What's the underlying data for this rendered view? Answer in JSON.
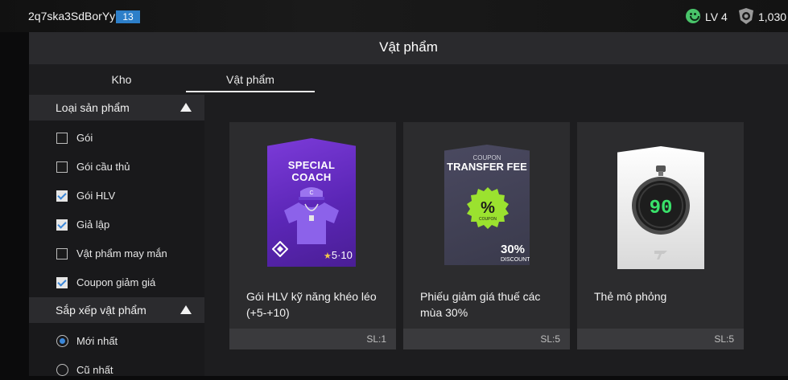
{
  "header": {
    "username": "2q7ska3SdBorYy",
    "badge": "13",
    "level": "LV 4",
    "currency": "1,030"
  },
  "title": "Vật phẩm",
  "tabs": [
    {
      "label": "Kho"
    },
    {
      "label": "Vật phẩm",
      "active": true
    }
  ],
  "sidebar": {
    "product_type_label": "Loại sản phẩm",
    "filters": [
      {
        "label": "Gói",
        "checked": false
      },
      {
        "label": "Gói cầu thủ",
        "checked": false
      },
      {
        "label": "Gói HLV",
        "checked": true
      },
      {
        "label": "Giả lập",
        "checked": true
      },
      {
        "label": "Vật phẩm may mắn",
        "checked": false
      },
      {
        "label": "Coupon giảm giá",
        "checked": true
      }
    ],
    "sort_label": "Sắp xếp vật phẩm",
    "sort_options": [
      {
        "label": "Mới nhất",
        "selected": true
      },
      {
        "label": "Cũ nhất",
        "selected": false
      }
    ]
  },
  "items": [
    {
      "card_title": "SPECIAL COACH",
      "rating": "5·10",
      "name": "Gói HLV kỹ năng khéo léo (+5-+10)",
      "qty": "SL:1"
    },
    {
      "card_caption": "COUPON",
      "card_title": "TRANSFER FEE",
      "badge_symbol": "%",
      "badge_caption": "COUPON",
      "percent": "30%",
      "discount_label": "DISCOUNT",
      "name": "Phiếu giảm giá thuế các mùa 30%",
      "qty": "SL:5"
    },
    {
      "timer_value": "90",
      "name": "Thẻ mô phỏng",
      "qty": "SL:5"
    }
  ],
  "colors": {
    "accent": "#3b87d9",
    "badge_blue": "#2d7fc9",
    "level_green": "#49c46a",
    "coach_purple": "#6a2fc6",
    "coupon_green": "#9be22f"
  }
}
